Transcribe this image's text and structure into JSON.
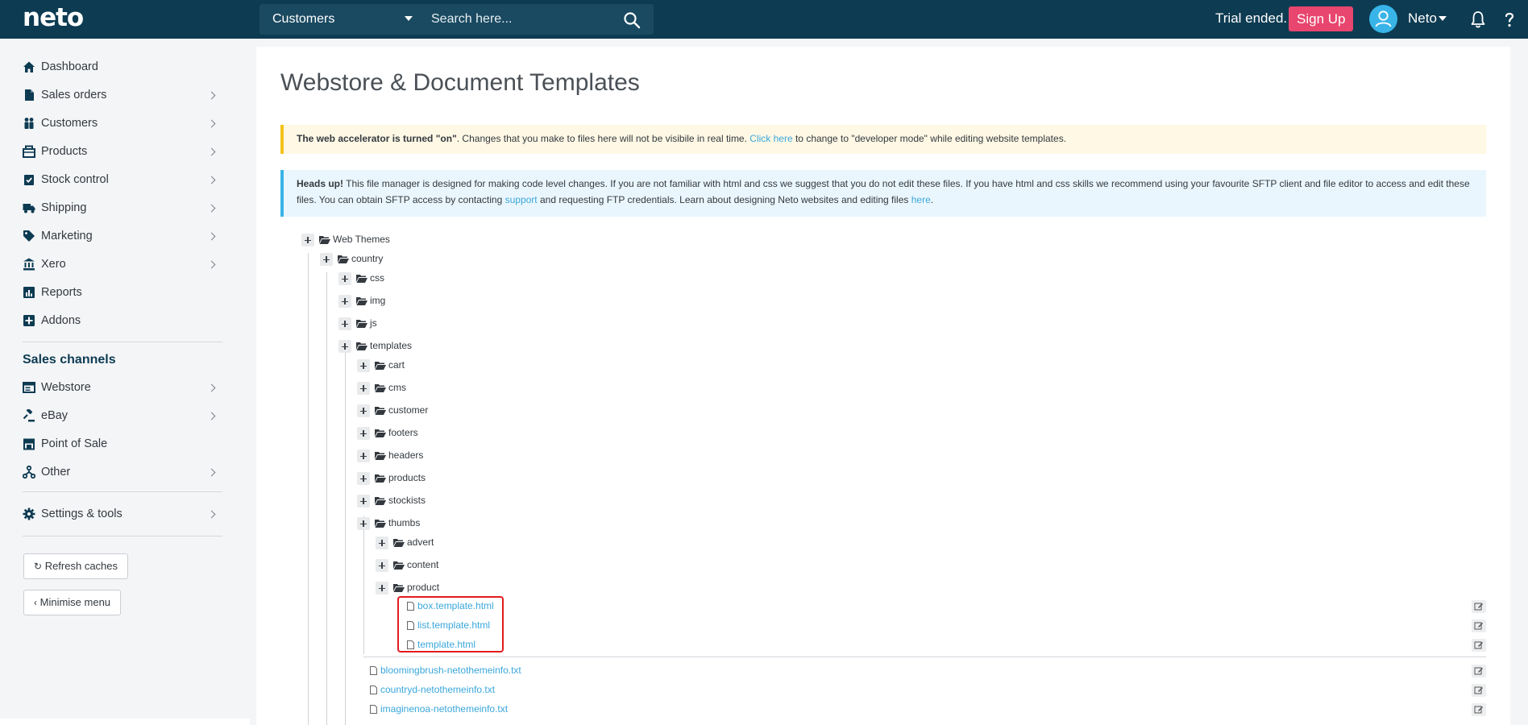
{
  "topbar": {
    "logo": "neto",
    "search_scope": "Customers",
    "search_placeholder": "Search here...",
    "trial_text": "Trial ended.",
    "signup_label": "Sign Up",
    "user_name": "Neto"
  },
  "sidebar": {
    "items": [
      {
        "label": "Dashboard",
        "icon": "home-icon"
      },
      {
        "label": "Sales orders",
        "icon": "document-icon"
      },
      {
        "label": "Customers",
        "icon": "people-icon"
      },
      {
        "label": "Products",
        "icon": "box-icon"
      },
      {
        "label": "Stock control",
        "icon": "clipboard-check-icon"
      },
      {
        "label": "Shipping",
        "icon": "truck-icon"
      },
      {
        "label": "Marketing",
        "icon": "tag-icon"
      },
      {
        "label": "Xero",
        "icon": "bank-icon"
      },
      {
        "label": "Reports",
        "icon": "chart-icon"
      },
      {
        "label": "Addons",
        "icon": "plus-square-icon"
      }
    ],
    "channels_title": "Sales channels",
    "channels": [
      {
        "label": "Webstore",
        "icon": "webstore-icon"
      },
      {
        "label": "eBay",
        "icon": "gavel-icon"
      },
      {
        "label": "Point of Sale",
        "icon": "store-icon"
      },
      {
        "label": "Other",
        "icon": "network-icon"
      }
    ],
    "settings_label": "Settings & tools",
    "refresh_label": "Refresh caches",
    "minimise_label": "Minimise menu"
  },
  "main": {
    "title": "Webstore & Document Templates",
    "warning": {
      "bold": "The web accelerator is turned \"on\"",
      "text1": ". Changes that you make to files here will not be visibile in real time. ",
      "link": "Click here",
      "text2": " to change to \"developer mode\" while editing website templates."
    },
    "info": {
      "bold": "Heads up!",
      "text1": " This file manager is designed for making code level changes. If you are not familiar with html and css we suggest that you do not edit these files. If you have html and css skills we recommend using your favourite SFTP client and file editor to access and edit these files. You can obtain SFTP access by contacting ",
      "link1": "support",
      "text2": " and requesting FTP credentials. Learn about designing Neto websites and editing files ",
      "link2": "here",
      "text3": "."
    }
  },
  "tree": {
    "root": "Web Themes",
    "country": "country",
    "level2": [
      "css",
      "img",
      "js",
      "templates"
    ],
    "templates": [
      "cart",
      "cms",
      "customer",
      "footers",
      "headers",
      "products",
      "stockists",
      "thumbs"
    ],
    "thumbs": [
      "advert",
      "content",
      "product"
    ],
    "product_files": [
      "box.template.html",
      "list.template.html",
      "template.html"
    ],
    "country_files": [
      "bloomingbrush-netothemeinfo.txt",
      "countryd-netothemeinfo.txt",
      "imaginenoa-netothemeinfo.txt"
    ]
  }
}
